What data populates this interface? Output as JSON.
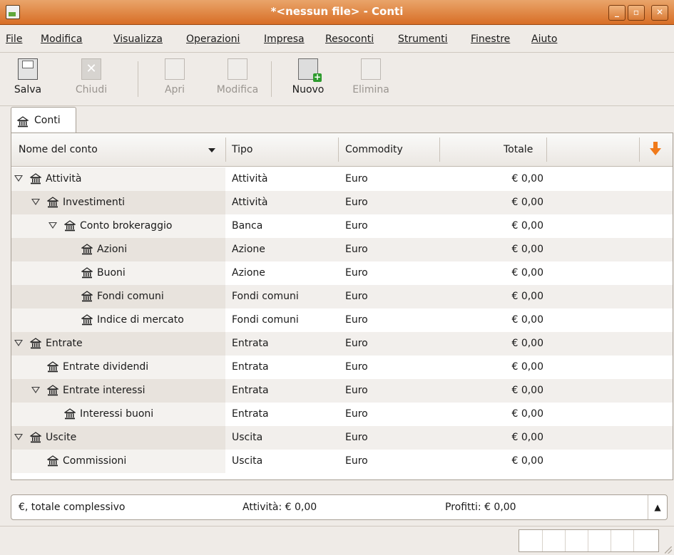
{
  "window": {
    "title": "*<nessun file> - Conti"
  },
  "menu": [
    "File",
    "Modifica",
    "Visualizza",
    "Operazioni",
    "Impresa",
    "Resoconti",
    "Strumenti",
    "Finestre",
    "Aiuto"
  ],
  "toolbar": {
    "save": "Salva",
    "close": "Chiudi",
    "open": "Apri",
    "edit": "Modifica",
    "new": "Nuovo",
    "delete": "Elimina"
  },
  "tab": {
    "label": "Conti"
  },
  "columns": {
    "name": "Nome del conto",
    "type": "Tipo",
    "commodity": "Commodity",
    "total": "Totale"
  },
  "accounts": [
    {
      "name": "Attività",
      "type": "Attività",
      "commodity": "Euro",
      "total": "€ 0,00",
      "level": 0,
      "expanded": true
    },
    {
      "name": "Investimenti",
      "type": "Attività",
      "commodity": "Euro",
      "total": "€ 0,00",
      "level": 1,
      "expanded": true
    },
    {
      "name": "Conto brokeraggio",
      "type": "Banca",
      "commodity": "Euro",
      "total": "€ 0,00",
      "level": 2,
      "expanded": true
    },
    {
      "name": "Azioni",
      "type": "Azione",
      "commodity": "Euro",
      "total": "€ 0,00",
      "level": 3,
      "expanded": false
    },
    {
      "name": "Buoni",
      "type": "Azione",
      "commodity": "Euro",
      "total": "€ 0,00",
      "level": 3,
      "expanded": false
    },
    {
      "name": "Fondi comuni",
      "type": "Fondi comuni",
      "commodity": "Euro",
      "total": "€ 0,00",
      "level": 3,
      "expanded": false
    },
    {
      "name": "Indice di mercato",
      "type": "Fondi comuni",
      "commodity": "Euro",
      "total": "€ 0,00",
      "level": 3,
      "expanded": false
    },
    {
      "name": "Entrate",
      "type": "Entrata",
      "commodity": "Euro",
      "total": "€ 0,00",
      "level": 0,
      "expanded": true
    },
    {
      "name": "Entrate dividendi",
      "type": "Entrata",
      "commodity": "Euro",
      "total": "€ 0,00",
      "level": 1,
      "expanded": false
    },
    {
      "name": "Entrate interessi",
      "type": "Entrata",
      "commodity": "Euro",
      "total": "€ 0,00",
      "level": 1,
      "expanded": true
    },
    {
      "name": "Interessi buoni",
      "type": "Entrata",
      "commodity": "Euro",
      "total": "€ 0,00",
      "level": 2,
      "expanded": false
    },
    {
      "name": "Uscite",
      "type": "Uscita",
      "commodity": "Euro",
      "total": "€ 0,00",
      "level": 0,
      "expanded": true
    },
    {
      "name": "Commissioni",
      "type": "Uscita",
      "commodity": "Euro",
      "total": "€ 0,00",
      "level": 1,
      "expanded": false
    }
  ],
  "summary": {
    "currency": "€, totale complessivo",
    "assets": "Attività: € 0,00",
    "profits": "Profitti: € 0,00"
  },
  "icons": {
    "account": "bank-icon",
    "sort": "sort-arrow-icon"
  }
}
